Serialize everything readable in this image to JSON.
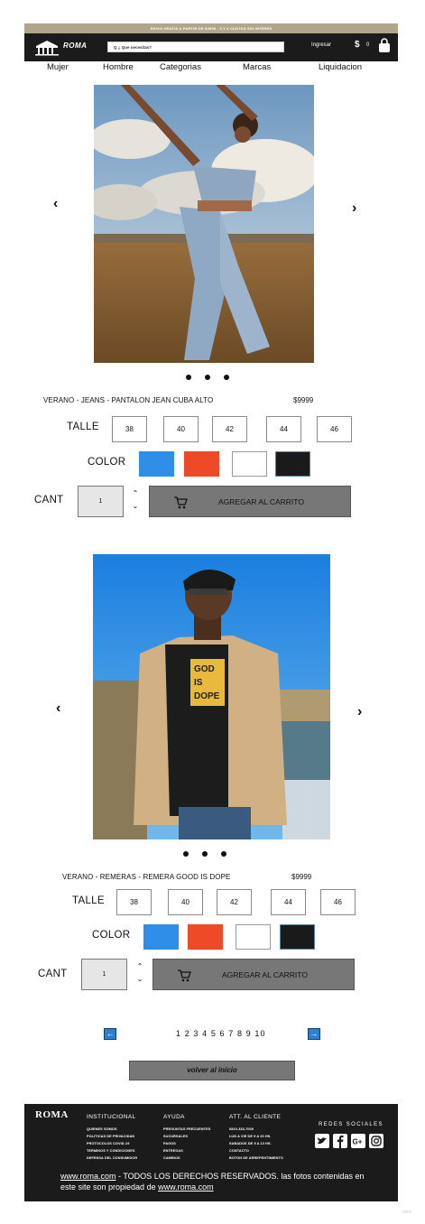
{
  "banner": {
    "text": "ENVIO GRATIS A PARTIR DE $4000 - 3 Y 6 CUOTAS SIN INTERES"
  },
  "header": {
    "logo_text": "ROMA",
    "search_placeholder": "Q ¿ Que necesitas?",
    "login_label": "Ingresar",
    "currency": "$",
    "cart_count": "0"
  },
  "nav": {
    "items": [
      "Mujer",
      "Hombre",
      "Categorias",
      "Marcas",
      "Liquidacion"
    ]
  },
  "labels": {
    "size": "TALLE",
    "color": "COLOR",
    "qty": "CANT",
    "add_to_cart": "AGREGAR AL CARRITO",
    "prev": "‹",
    "next": "›"
  },
  "products": [
    {
      "name": "VERANO - JEANS - PANTALON JEAN CUBA ALTO",
      "price": "$9999",
      "sizes": [
        "38",
        "40",
        "42",
        "44",
        "46"
      ],
      "colors": [
        "#2f8fe8",
        "#ee4a28",
        "#ffffff",
        "#1a1a1a"
      ],
      "quantity": "1"
    },
    {
      "name": "VERANO - REMERAS - REMERA GOOD IS DOPE",
      "price": "$9999",
      "sizes": [
        "38",
        "40",
        "42",
        "44",
        "46"
      ],
      "colors": [
        "#2f8fe8",
        "#ee4a28",
        "#ffffff",
        "#1a1a1a"
      ],
      "quantity": "1"
    }
  ],
  "pagination": {
    "prev": "←",
    "next": "→",
    "pages": "1 2 3 4 5 6 7 8 9 10"
  },
  "back_button": "volver al inicio",
  "footer": {
    "logo": "ROMA",
    "columns": [
      {
        "title": "INSTITUCIONAL",
        "links": [
          "QUIENES SOMOS",
          "POLITICAS DE PRIVACIDAD",
          "PROTOCOLOS COVID-19",
          "TERMINOS Y CONDICIONES",
          "DEFENSA DEL CONSUMIDOR"
        ]
      },
      {
        "title": "AYUDA",
        "links": [
          "PREGUNTAS FRECUENTES",
          "SUCURSALES",
          "PAGOS",
          "ENTREGAS",
          "CAMBIOS"
        ]
      },
      {
        "title": "ATT. AL CLIENTE",
        "links": [
          "0810-333-7000",
          "LUN A VIE DE 9 A 20 HS.",
          "SABADOS DE 9 A 13 HS.",
          "CONTACTO",
          "BOTON DE ARREPENTIMIENTO"
        ]
      }
    ],
    "social_title": "REDES SOCIALES",
    "social_icons": [
      "twitter-icon",
      "facebook-icon",
      "google-plus-icon",
      "instagram-icon"
    ],
    "legal_link": "www.roma.com",
    "legal_text": " - TODOS LOS DERECHOS RESERVADOS. las fotos contenidas en este site son propiedad de ",
    "legal_link2": "www.roma.com"
  },
  "watermark": "miro"
}
